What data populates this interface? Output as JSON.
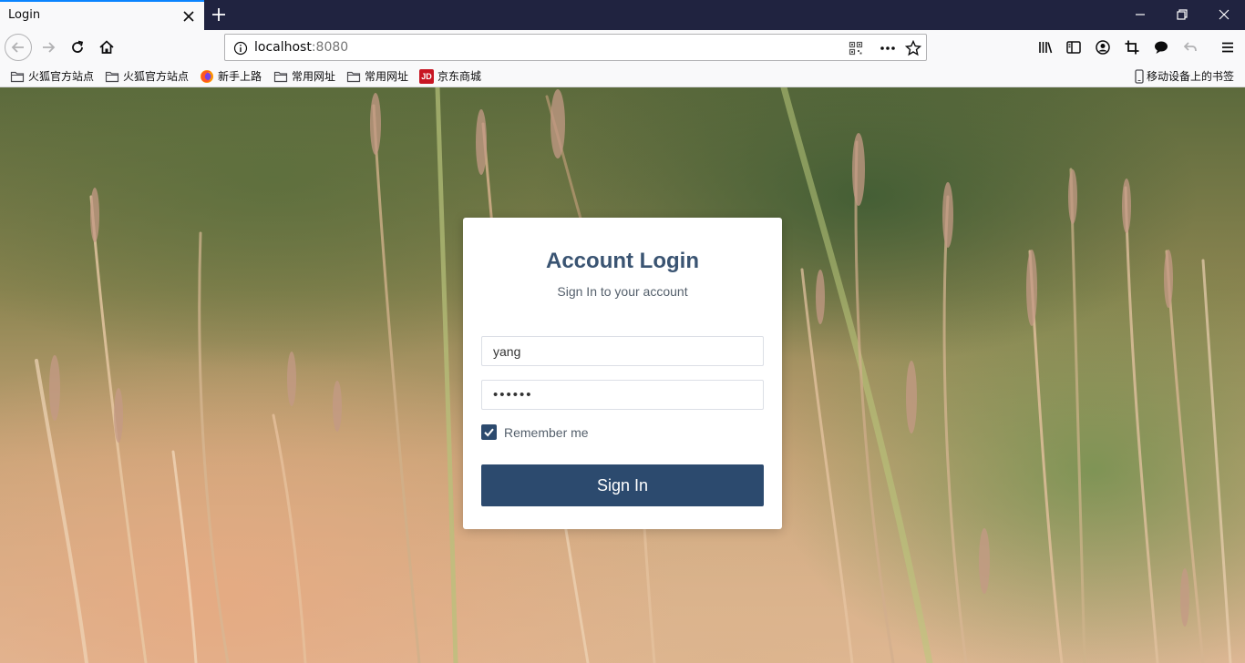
{
  "browser": {
    "tab": {
      "title": "Login"
    },
    "url": {
      "host": "localhost",
      "port": ":8080"
    },
    "bookmarks": [
      {
        "label": "火狐官方站点",
        "icon": "folder-icon"
      },
      {
        "label": "火狐官方站点",
        "icon": "folder-icon"
      },
      {
        "label": "新手上路",
        "icon": "firefox-icon"
      },
      {
        "label": "常用网址",
        "icon": "folder-icon"
      },
      {
        "label": "常用网址",
        "icon": "folder-icon"
      },
      {
        "label": "京东商城",
        "icon": "jd-icon",
        "icon_text": "JD"
      }
    ],
    "mobile_bookmarks": "移动设备上的书签"
  },
  "login": {
    "title": "Account Login",
    "subtitle": "Sign In to your account",
    "username": "yang",
    "password_mask": "••••••",
    "remember_label": "Remember me",
    "remember_checked": true,
    "signin_label": "Sign In"
  },
  "colors": {
    "accent": "#2c4a6e",
    "title": "#3a5472",
    "tabstrip": "#202340",
    "tab_highlight": "#0a84ff"
  }
}
